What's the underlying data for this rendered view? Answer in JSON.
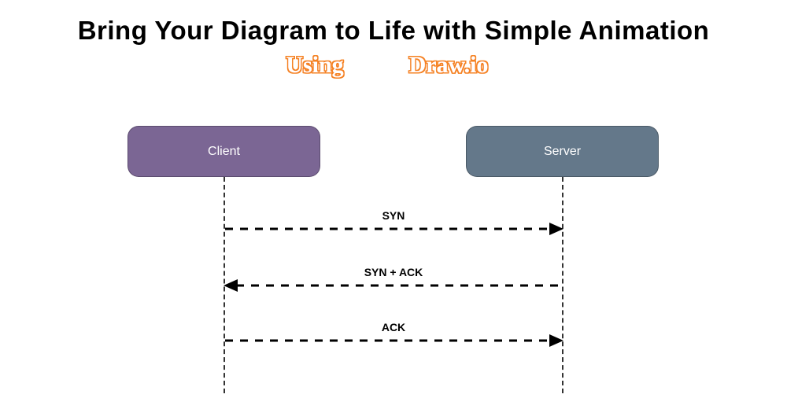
{
  "title": "Bring Your Diagram to Life with Simple Animation",
  "subtitle_word1": "Using",
  "subtitle_word2": "Draw.io",
  "nodes": {
    "client": "Client",
    "server": "Server"
  },
  "messages": {
    "m1": "SYN",
    "m2": "SYN + ACK",
    "m3": "ACK"
  },
  "colors": {
    "client_bg": "#7b6694",
    "server_bg": "#64788a",
    "subtitle": "#f58220"
  }
}
